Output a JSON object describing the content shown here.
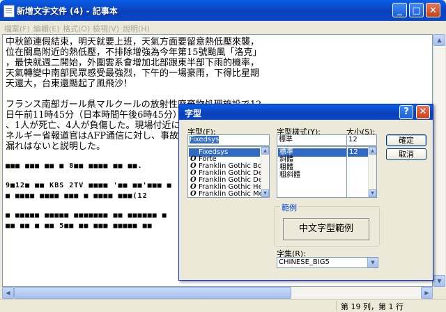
{
  "window": {
    "title": "新增文字文件 (4) - 記事本",
    "buttons": {
      "minimize": "_",
      "maximize": "□",
      "close": "✕"
    }
  },
  "menu": [
    "檔案(F)",
    "編輯(E)",
    "格式(O)",
    "檢視(V)",
    "說明(H)"
  ],
  "editor": {
    "lines": [
      "中秋節連假結束，明天就要上班，天氣方面要留意熱低壓來襲，",
      "位在關島附近的熱低壓，不排除增強為今年第15號颱風「洛克」",
      "，最快就週二開始，外圍雲系會增加北部跟東半部下雨的機率，",
      "天氣轉變中南部民眾感受最強烈，下午的一場豪雨，下得比星期",
      "天還大，台東還颳起了風飛沙！",
      "",
      "フランス南部ガール県マルクールの放射性廃棄物処理施設で12",
      "日午前11時45分（日本時間午後6時45分）ごろ、爆発事故が起き",
      "、1人が死亡、4人が負傷した。現場付近に",
      "ネルギー省報道官はAFP通信に対し、事故に",
      "漏れはないと説明した。",
      "",
      "■■■ ■■■ ■■ ■ 8■■ ■■■■ ■■ ■■.",
      "",
      "9■12■ ■■ KBS 2TV ■■■■  '■■ ■■'■■■ ■",
      "■ ■■■■ ■■■■ ■■■ ■ ■■■■ ■■■(12",
      "",
      "■ ■■■■■ ■■■■■ ■■■■■■■ ■■ ■■■■■■ ■",
      "■■ ■■ ■ ■■ 5■■ ■■ ■■■ ■■■■■ ■■"
    ]
  },
  "status": {
    "position": "第 19 列，第 1 行"
  },
  "dialog": {
    "title": "字型",
    "font": {
      "label": "字型(F):",
      "value": "Fixedsys",
      "options": [
        "Fixedsys",
        "Forte",
        "Franklin Gothic Book",
        "Franklin Gothic Demi",
        "Franklin Gothic Demi C",
        "Franklin Gothic Heavy",
        "Franklin Gothic Mediu"
      ],
      "selected_index": 0
    },
    "style": {
      "label": "字型樣式(Y):",
      "value": "標準",
      "options": [
        "標準",
        "斜體",
        "粗體",
        "粗斜體"
      ],
      "selected_index": 0
    },
    "size": {
      "label": "大小(S):",
      "value": "12",
      "options": [
        "12"
      ],
      "selected_index": 0
    },
    "ok_label": "確定",
    "cancel_label": "取消",
    "sample_group_label": "範例",
    "sample_text": "中文字型範例",
    "script": {
      "label": "字集(R):",
      "value": "CHINESE_BIG5"
    }
  },
  "colors": {
    "title_blue": "#0a5ee6",
    "selection": "#316ac5"
  }
}
